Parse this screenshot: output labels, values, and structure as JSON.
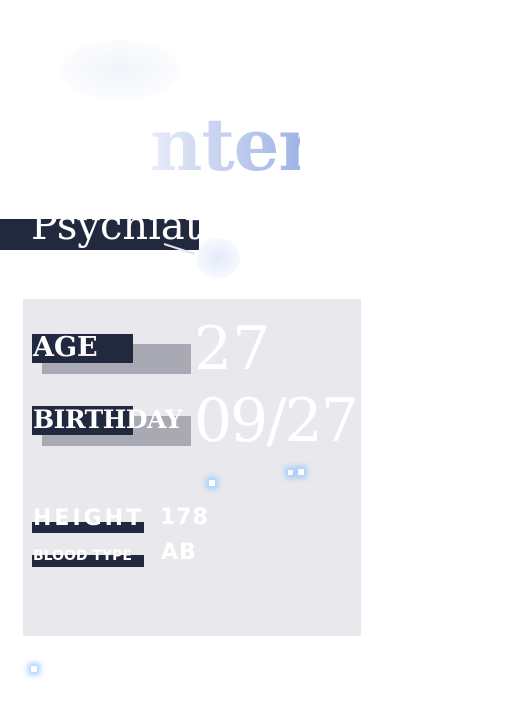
{
  "header": {
    "title_fragment": "nter",
    "banner_fragment": "Psychiat"
  },
  "profile": {
    "age": {
      "label": "AGE",
      "value": "27"
    },
    "birthday": {
      "label": "BIRTHDAY",
      "value": "09/27"
    },
    "height": {
      "label": "HEIGHT",
      "value": "178"
    },
    "blood_type": {
      "label": "BLOOD TYPE",
      "value": "AB"
    }
  },
  "colors": {
    "navy": "#22283d",
    "card": "#e9e9ed",
    "shadow_gray": "#a9a9b3",
    "title_blue": "#9fb3e6"
  }
}
